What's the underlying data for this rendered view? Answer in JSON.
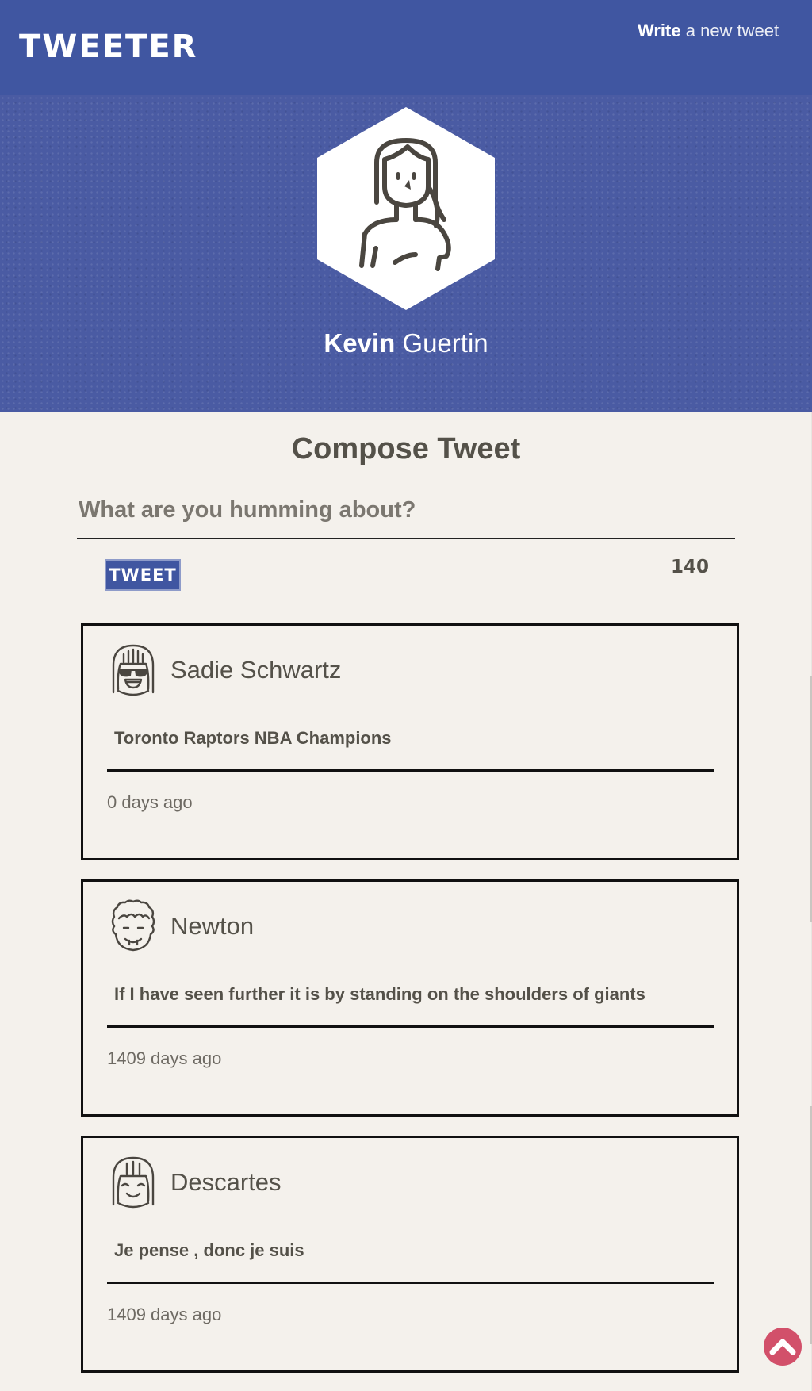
{
  "nav": {
    "logo": "TWEETER",
    "compose_link_bold": "Write",
    "compose_link_rest": "a new tweet"
  },
  "profile": {
    "first_name": "Kevin",
    "last_name": "Guertin",
    "avatar_icon": "user-avatar-icon"
  },
  "compose": {
    "title": "Compose Tweet",
    "placeholder": "What are you humming about?",
    "button_label": "TWEET",
    "counter": "140"
  },
  "tweets": [
    {
      "name": "Sadie Schwartz",
      "text": "Toronto Raptors NBA Champions",
      "time": "0 days ago",
      "avatar_icon": "sunglasses-avatar-icon"
    },
    {
      "name": "Newton",
      "text": "If I have seen further it is by standing on the shoulders of giants",
      "time": "1409 days ago",
      "avatar_icon": "curly-hair-avatar-icon"
    },
    {
      "name": "Descartes",
      "text": "Je pense , donc je suis",
      "time": "1409 days ago",
      "avatar_icon": "smiling-avatar-icon"
    }
  ],
  "colors": {
    "nav_bg": "#4056a1",
    "page_bg": "#f4f1ec",
    "text": "#545149",
    "scroll_top_button": "#d2506a"
  }
}
